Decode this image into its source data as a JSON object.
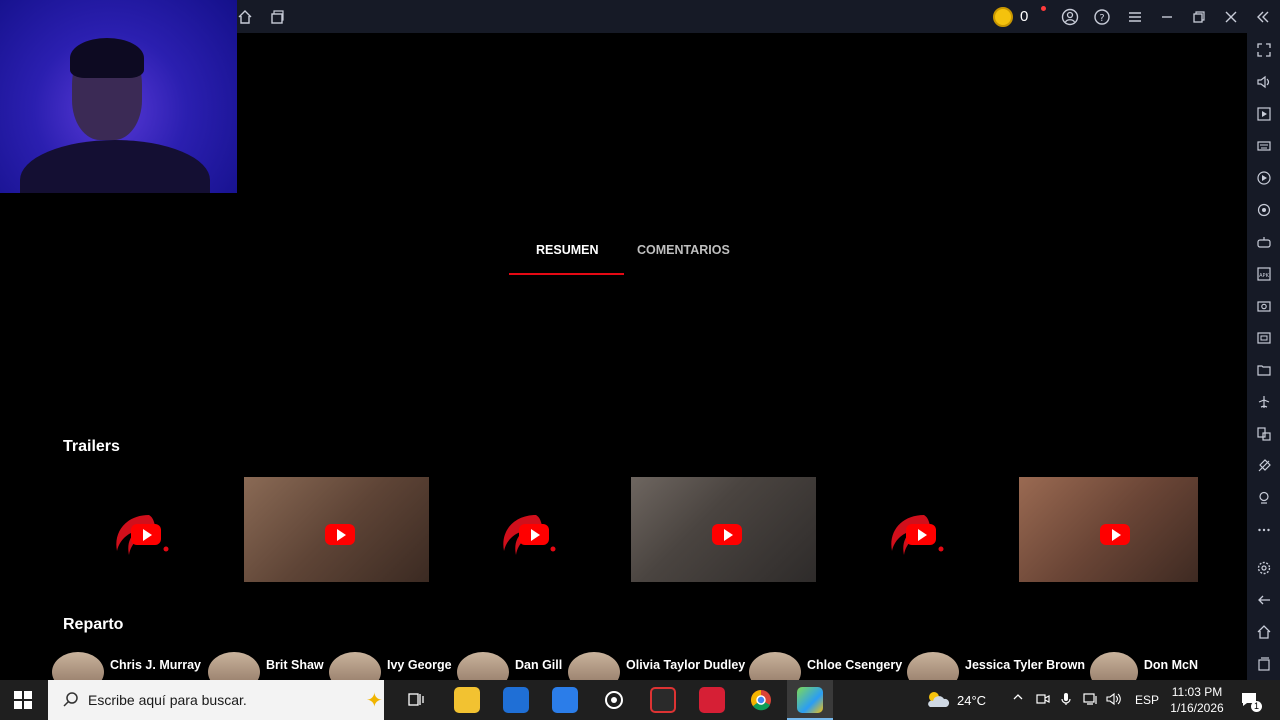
{
  "topbar": {
    "coin_count": "0"
  },
  "tabs": [
    {
      "label": "RESUMEN",
      "active": true
    },
    {
      "label": "COMENTARIOS",
      "active": false
    }
  ],
  "sections": {
    "trailers_title": "Trailers",
    "cast_title": "Reparto"
  },
  "trailers": [
    {
      "kind": "logo",
      "thumb": "app-logo"
    },
    {
      "kind": "video",
      "thumb": "doll-scene"
    },
    {
      "kind": "logo",
      "thumb": "app-logo"
    },
    {
      "kind": "video",
      "thumb": "interview"
    },
    {
      "kind": "logo",
      "thumb": "app-logo"
    },
    {
      "kind": "video",
      "thumb": "girl-scene"
    }
  ],
  "cast": [
    {
      "name": "Chris J. Murray"
    },
    {
      "name": "Brit Shaw"
    },
    {
      "name": "Ivy George"
    },
    {
      "name": "Dan Gill"
    },
    {
      "name": "Olivia Taylor Dudley"
    },
    {
      "name": "Chloe Csengery"
    },
    {
      "name": "Jessica Tyler Brown"
    },
    {
      "name": "Don McN"
    }
  ],
  "taskbar": {
    "search_placeholder": "Escribe aquí para buscar.",
    "weather": "24°C",
    "language": "ESP",
    "time": "11:03 PM",
    "date": "1/16/2026",
    "notification_count": "1"
  },
  "colors": {
    "accent": "#e50914",
    "bar": "#161a26",
    "play": "#ff0000"
  },
  "sidebar_icons": [
    "fullscreen-icon",
    "volume-icon",
    "media-icon",
    "keyboard-icon",
    "macro-icon",
    "sync-icon",
    "controller-icon",
    "apk-icon",
    "screenshot-icon",
    "record-icon",
    "folder-icon",
    "airplane-icon",
    "multi-instance-icon",
    "eco-icon",
    "location-icon",
    "more-icon",
    "settings-icon",
    "back-icon",
    "home-icon",
    "recents-icon"
  ]
}
